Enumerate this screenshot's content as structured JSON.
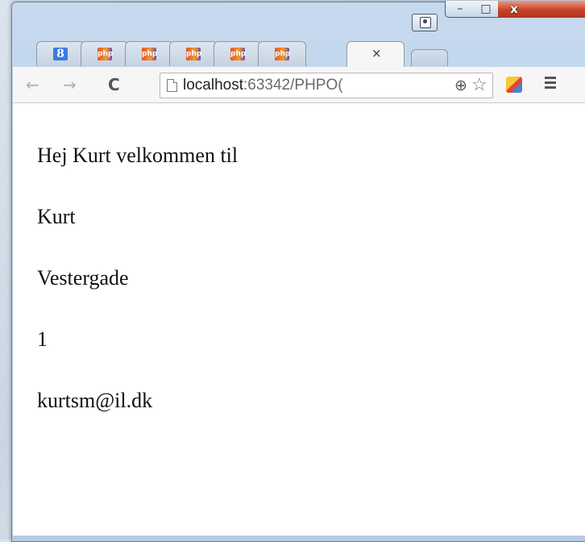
{
  "window": {
    "controls": {
      "minimize": "–",
      "maximize": "□",
      "close": "x"
    }
  },
  "tabs": [
    {
      "icon": "google-icon",
      "glyph": "8"
    },
    {
      "icon": "php-icon",
      "glyph": "php"
    },
    {
      "icon": "php-icon",
      "glyph": "php"
    },
    {
      "icon": "php-icon",
      "glyph": "php"
    },
    {
      "icon": "php-icon",
      "glyph": "php"
    },
    {
      "icon": "php-icon",
      "glyph": "php"
    },
    {
      "icon": "none",
      "close": "×"
    }
  ],
  "toolbar": {
    "back": "←",
    "forward": "→",
    "reload": "C",
    "url_host": "localhost",
    "url_rest": ":63342/PHPO(",
    "zoom": "⊕",
    "star": "☆"
  },
  "content": {
    "lines": [
      "Hej Kurt velkommen til",
      "Kurt",
      "Vestergade",
      "1",
      "kurtsm@il.dk"
    ]
  },
  "colors": {
    "window_frame": "#b5cbe3",
    "close_button": "#c8452a",
    "page_background": "#ffffff"
  }
}
